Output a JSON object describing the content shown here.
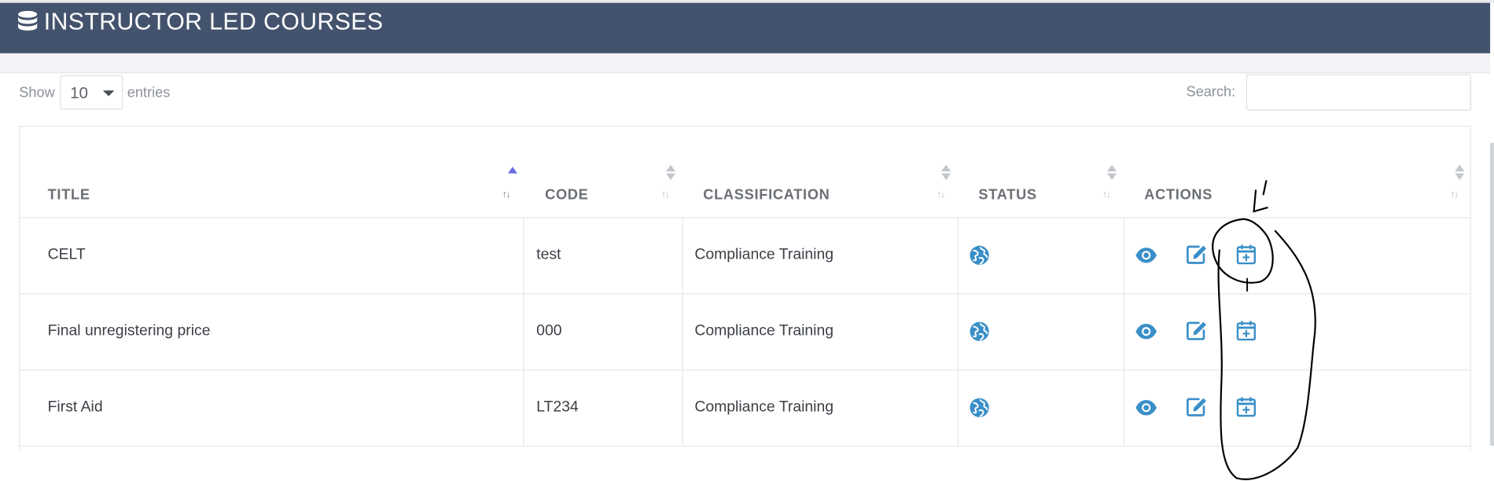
{
  "page": {
    "title": "INSTRUCTOR LED COURSES",
    "title_icon": "database-icon"
  },
  "length_control": {
    "show_label": "Show",
    "selected": "10",
    "entries_label": "entries"
  },
  "search": {
    "label": "Search:",
    "value": ""
  },
  "table": {
    "columns": [
      {
        "label": "TITLE",
        "sort": "ascending"
      },
      {
        "label": "CODE",
        "sort": "none"
      },
      {
        "label": "CLASSIFICATION",
        "sort": "none"
      },
      {
        "label": "STATUS",
        "sort": "none"
      },
      {
        "label": "ACTIONS",
        "sort": "none"
      }
    ],
    "rows": [
      {
        "title": "CELT",
        "code": "test",
        "classification": "Compliance Training",
        "status_icon": "globe-icon"
      },
      {
        "title": "Final unregistering price",
        "code": "000",
        "classification": "Compliance Training",
        "status_icon": "globe-icon"
      },
      {
        "title": "First Aid",
        "code": "LT234",
        "classification": "Compliance Training",
        "status_icon": "globe-icon"
      }
    ],
    "row_actions": [
      "view-eye-icon",
      "edit-pencil-icon",
      "calendar-add-icon"
    ]
  },
  "colors": {
    "header_bg": "#44536d",
    "accent_blue": "#3a8fc8",
    "sort_active": "#6a6ee0"
  }
}
